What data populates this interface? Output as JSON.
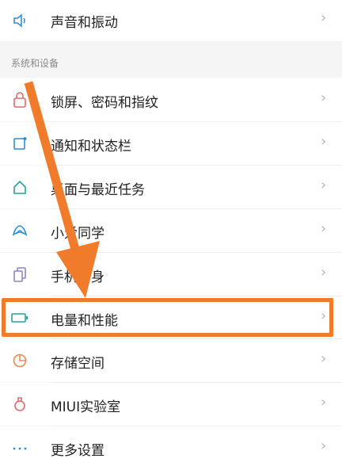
{
  "colors": {
    "accent_top": "#4db6ac",
    "annotation_orange": "#f07b2a"
  },
  "top_item": {
    "label": "声音和振动",
    "icon": "speaker-icon"
  },
  "section": {
    "title": "系统和设备"
  },
  "items": [
    {
      "label": "锁屏、密码和指纹",
      "icon": "lock-icon",
      "icon_color": "#e06a6a"
    },
    {
      "label": "通知和状态栏",
      "icon": "notification-icon",
      "icon_color": "#2e8fd6"
    },
    {
      "label": "桌面与最近任务",
      "icon": "home-icon",
      "icon_color": "#23a39b"
    },
    {
      "label": "小爱同学",
      "icon": "assistant-icon",
      "icon_color": "#2e8fd6"
    },
    {
      "label": "手机分身",
      "icon": "clone-icon",
      "icon_color": "#8a86c7"
    },
    {
      "label": "电量和性能",
      "icon": "battery-icon",
      "icon_color": "#23a39b"
    },
    {
      "label": "存储空间",
      "icon": "storage-icon",
      "icon_color": "#e88a55"
    },
    {
      "label": "MIUI实验室",
      "icon": "lab-flask-icon",
      "icon_color": "#e06a6a"
    },
    {
      "label": "更多设置",
      "icon": "more-icon",
      "icon_color": "#2e8fd6"
    }
  ],
  "chevron": "›"
}
